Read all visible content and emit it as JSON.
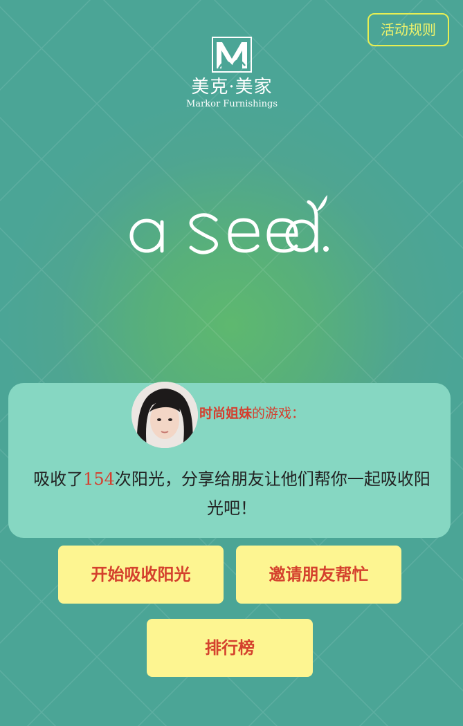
{
  "header": {
    "rules_label": "活动规则"
  },
  "brand": {
    "logo_mark_icon": "markor-m-logo-icon",
    "name_cn": "美克·美家",
    "name_en": "Markor Furnishings",
    "campaign_logo_icon": "a-seed-logo-icon"
  },
  "card": {
    "owner_name": "时尚姐妹",
    "owner_suffix": "的游戏：",
    "message_prefix": "吸收了",
    "sunlight_count": "154",
    "message_suffix": "次阳光，分享给朋友让他们帮你一起吸收阳光吧！"
  },
  "buttons": {
    "start_label": "开始吸收阳光",
    "invite_label": "邀请朋友帮忙",
    "rank_label": "排行榜"
  },
  "colors": {
    "background": "#4ba596",
    "card": "#86d7c2",
    "button_bg": "#fdf591",
    "button_text": "#d4412d",
    "rules_border": "#e7ef53"
  }
}
